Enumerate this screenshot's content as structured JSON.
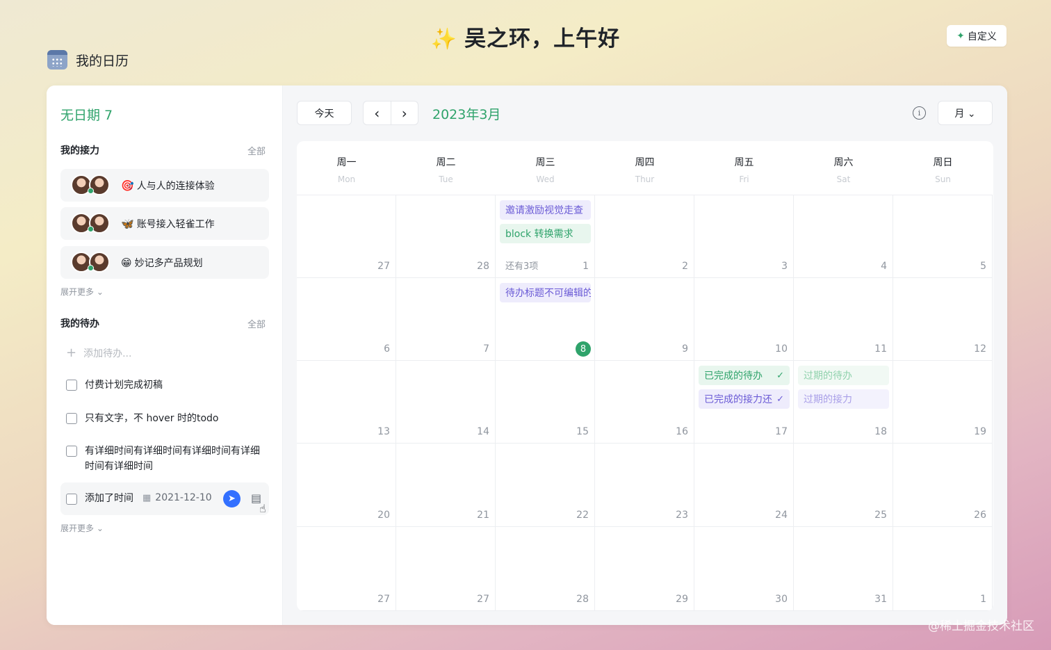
{
  "greeting": {
    "icon": "sparkles-icon",
    "text": "吴之环，上午好"
  },
  "customize": {
    "label": "自定义",
    "icon": "sparkle-icon"
  },
  "calendar_title": "我的日历",
  "sidebar": {
    "no_date": "无日期 7",
    "relay": {
      "title": "我的接力",
      "all": "全部",
      "items": [
        {
          "emoji": "🎯",
          "label": "人与人的连接体验"
        },
        {
          "emoji": "🦋",
          "label": "账号接入轻雀工作"
        },
        {
          "emoji": "😁",
          "label": "妙记多产品规划"
        }
      ],
      "expand": "展开更多 ⌄"
    },
    "todos": {
      "title": "我的待办",
      "all": "全部",
      "add_placeholder": "添加待办...",
      "items": [
        {
          "label": "付费计划完成初稿"
        },
        {
          "label": "只有文字，不 hover 时的todo"
        },
        {
          "label": "有详细时间有详细时间有详细时间有详细时间有详细时间"
        }
      ],
      "hover_item": {
        "label": "添加了时间",
        "date": "2021-12-10"
      },
      "expand": "展开更多 ⌄"
    }
  },
  "toolbar": {
    "today": "今天",
    "prev": "‹",
    "next": "›",
    "month_title": "2023年3月",
    "info": "i",
    "view": "月 ⌄"
  },
  "weekdays": [
    {
      "zh": "周一",
      "en": "Mon"
    },
    {
      "zh": "周二",
      "en": "Tue"
    },
    {
      "zh": "周三",
      "en": "Wed"
    },
    {
      "zh": "周四",
      "en": "Thur"
    },
    {
      "zh": "周五",
      "en": "Fri"
    },
    {
      "zh": "周六",
      "en": "Sat"
    },
    {
      "zh": "周日",
      "en": "Sun"
    }
  ],
  "weeks": [
    [
      "27",
      "28",
      "1",
      "2",
      "3",
      "4",
      "5"
    ],
    [
      "6",
      "7",
      "8",
      "9",
      "10",
      "11",
      "12"
    ],
    [
      "13",
      "14",
      "15",
      "16",
      "17",
      "18",
      "19"
    ],
    [
      "20",
      "21",
      "22",
      "23",
      "24",
      "25",
      "26"
    ],
    [
      "27",
      "27",
      "28",
      "29",
      "30",
      "31",
      "1"
    ]
  ],
  "today_cell": {
    "week": 1,
    "day": 2
  },
  "more_link": {
    "week": 0,
    "day": 2,
    "label": "还有3项"
  },
  "events": [
    {
      "week": 0,
      "day": 2,
      "slot": 0,
      "label": "邀请激励视觉走查",
      "style": "purple",
      "check": ""
    },
    {
      "week": 0,
      "day": 2,
      "slot": 1,
      "label": "block 转换需求",
      "style": "green",
      "check": ""
    },
    {
      "week": 1,
      "day": 2,
      "slot": 0,
      "label": "待办标题不可编辑的",
      "style": "purple",
      "check": ""
    },
    {
      "week": 2,
      "day": 4,
      "slot": 0,
      "label": "已完成的待办",
      "style": "green",
      "check": "✓"
    },
    {
      "week": 2,
      "day": 4,
      "slot": 1,
      "label": "已完成的接力还",
      "style": "purple",
      "check": "✓"
    },
    {
      "week": 2,
      "day": 5,
      "slot": 0,
      "label": "过期的待办",
      "style": "greenf",
      "check": ""
    },
    {
      "week": 2,
      "day": 5,
      "slot": 1,
      "label": "过期的接力",
      "style": "purplef",
      "check": ""
    }
  ],
  "watermark": "@稀土掘金技术社区"
}
